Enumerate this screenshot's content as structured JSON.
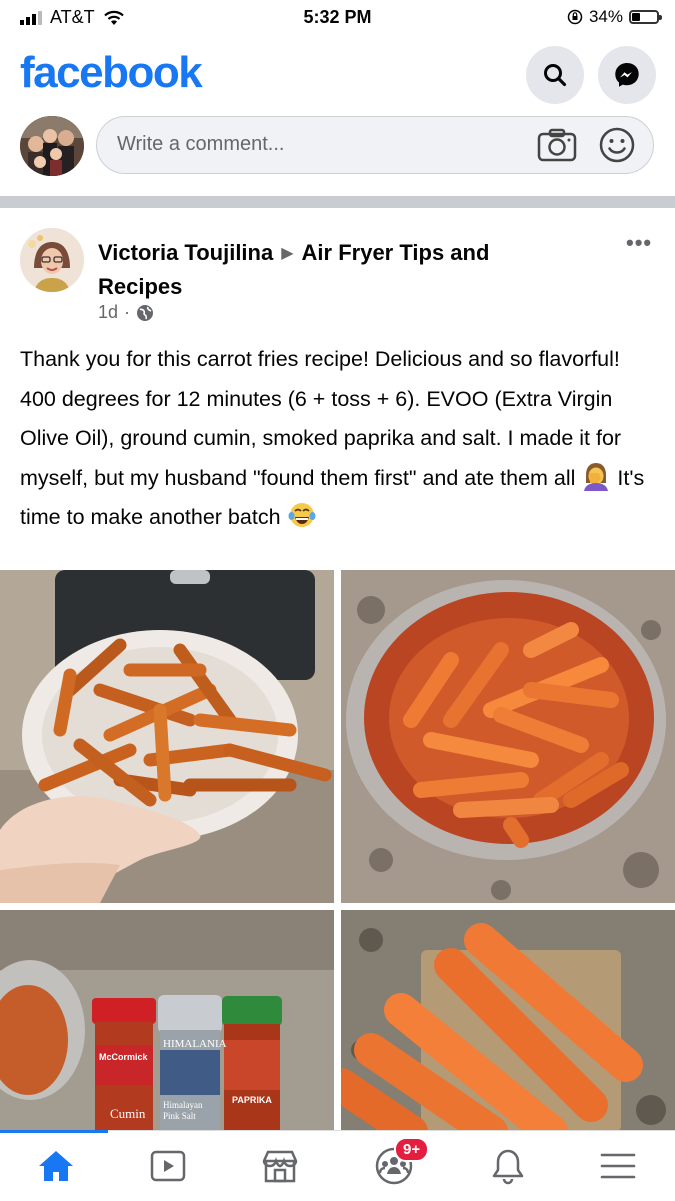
{
  "status_bar": {
    "carrier": "AT&T",
    "time": "5:32 PM",
    "battery": "34%",
    "battery_level": 0.34
  },
  "header": {
    "logo": "facebook",
    "search_icon": "search-icon",
    "messenger_icon": "messenger-icon"
  },
  "composer": {
    "placeholder": "Write a comment...",
    "camera_icon": "camera-icon",
    "emoji_icon": "smiley-icon"
  },
  "post": {
    "author": "Victoria Toujilina",
    "group": "Air Fryer Tips and Recipes",
    "time": "1d",
    "separator": "·",
    "privacy_icon": "globe-icon",
    "more": "•••",
    "text_part1": "Thank you for this carrot fries recipe! Delicious and so flavorful! 400 degrees for 12 minutes (6 + toss + 6). EVOO (Extra Virgin Olive Oil), ground cumin, smoked paprika and salt. I made it for myself, but my husband \"found them first\" and ate them all",
    "text_part2": " It's time to make another batch",
    "photos": [
      {
        "subject": "roasted carrot fries in a white bowl"
      },
      {
        "subject": "raw carrot sticks in a steel bowl"
      },
      {
        "subject": "spice jars"
      },
      {
        "subject": "whole peeled carrots"
      }
    ],
    "spice_labels": {
      "cumin_brand": "McCormick",
      "cumin": "Cumin",
      "salt_brand": "HIMALANIA",
      "salt": "Himalayan Pink Salt",
      "paprika": "PAPRIKA"
    }
  },
  "tabbar": {
    "tabs": [
      {
        "name": "home",
        "icon": "home-icon",
        "active": true
      },
      {
        "name": "watch",
        "icon": "video-icon"
      },
      {
        "name": "marketplace",
        "icon": "marketplace-icon"
      },
      {
        "name": "groups",
        "icon": "groups-icon",
        "badge": "9+"
      },
      {
        "name": "notifications",
        "icon": "bell-icon"
      },
      {
        "name": "menu",
        "icon": "menu-icon"
      }
    ]
  },
  "colors": {
    "brand": "#1877f2",
    "badge": "#e41e3f",
    "secondary_text": "#65676b"
  }
}
